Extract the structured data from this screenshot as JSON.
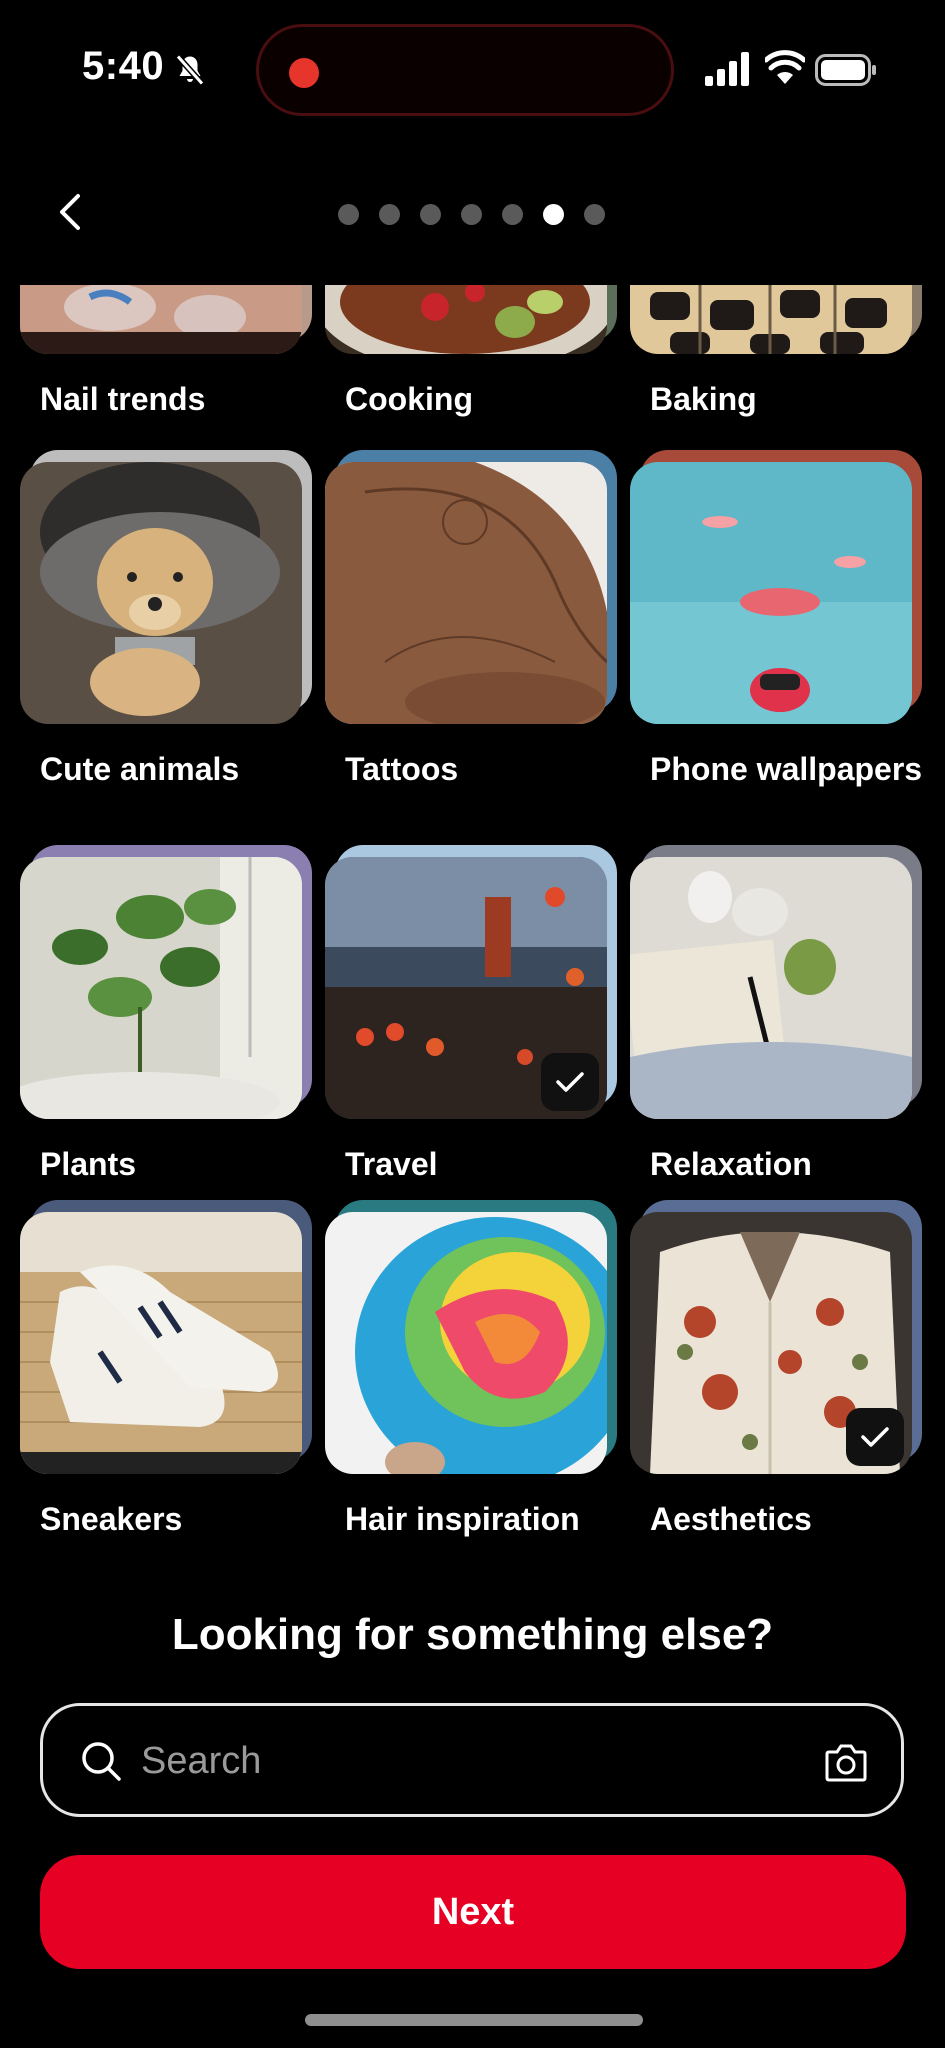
{
  "status_bar": {
    "time": "5:40",
    "icons": [
      "bell-slash-icon",
      "signal-icon",
      "wifi-icon",
      "battery-icon"
    ]
  },
  "header": {
    "back_icon": "chevron-left-icon",
    "progress": {
      "total_steps": 7,
      "current_step": 6
    }
  },
  "topics": [
    {
      "label": "Nail trends",
      "selected": false
    },
    {
      "label": "Cooking",
      "selected": false
    },
    {
      "label": "Baking",
      "selected": false
    },
    {
      "label": "Cute animals",
      "selected": false
    },
    {
      "label": "Tattoos",
      "selected": false
    },
    {
      "label": "Phone wallpapers",
      "selected": false
    },
    {
      "label": "Plants",
      "selected": false
    },
    {
      "label": "Travel",
      "selected": true
    },
    {
      "label": "Relaxation",
      "selected": false
    },
    {
      "label": "Sneakers",
      "selected": false
    },
    {
      "label": "Hair inspiration",
      "selected": false
    },
    {
      "label": "Aesthetics",
      "selected": true
    }
  ],
  "prompt": {
    "title": "Looking for something else?"
  },
  "search": {
    "placeholder": "Search",
    "value": ""
  },
  "next_button": {
    "label": "Next"
  },
  "colors": {
    "accent": "#e60023",
    "background": "#000000"
  }
}
